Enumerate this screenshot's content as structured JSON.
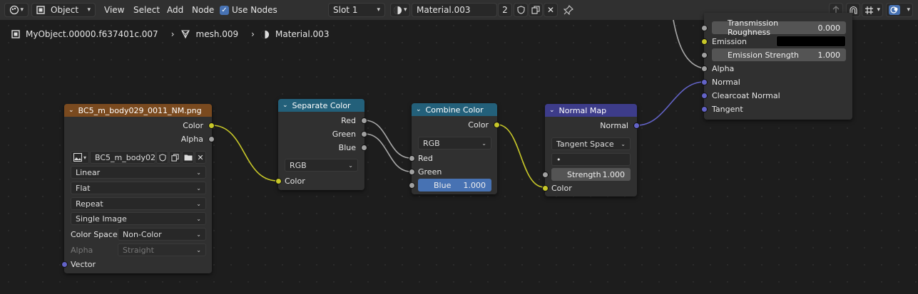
{
  "header": {
    "mode": "Object",
    "menus": [
      "View",
      "Select",
      "Add",
      "Node"
    ],
    "use_nodes": "Use Nodes",
    "slot": "Slot 1",
    "material": "Material.003",
    "user_count": "2"
  },
  "breadcrumb": {
    "object": "MyObject.00000.f637401c.007",
    "mesh": "mesh.009",
    "material": "Material.003"
  },
  "bsdf": {
    "transmission_roughness_label": "Transmission Roughness",
    "transmission_roughness_value": "0.000",
    "emission_label": "Emission",
    "emission_strength_label": "Emission Strength",
    "emission_strength_value": "1.000",
    "alpha": "Alpha",
    "normal": "Normal",
    "clearcoat_normal": "Clearcoat Normal",
    "tangent": "Tangent"
  },
  "image_node": {
    "title": "BC5_m_body029_0011_NM.png",
    "out_color": "Color",
    "out_alpha": "Alpha",
    "image_name": "BC5_m_body02...",
    "interpolation": "Linear",
    "projection": "Flat",
    "extension": "Repeat",
    "source": "Single Image",
    "color_space_label": "Color Space",
    "color_space": "Non-Color",
    "alpha_label": "Alpha",
    "alpha_mode": "Straight",
    "in_vector": "Vector"
  },
  "separate_node": {
    "title": "Separate Color",
    "out_red": "Red",
    "out_green": "Green",
    "out_blue": "Blue",
    "mode": "RGB",
    "in_color": "Color"
  },
  "combine_node": {
    "title": "Combine Color",
    "out_color": "Color",
    "mode": "RGB",
    "in_red": "Red",
    "in_green": "Green",
    "blue_label": "Blue",
    "blue_value": "1.000"
  },
  "normalmap_node": {
    "title": "Normal Map",
    "out_normal": "Normal",
    "space": "Tangent Space",
    "uv_map": "•",
    "strength_label": "Strength",
    "strength_value": "1.000",
    "in_color": "Color"
  },
  "colors": {
    "image_header": "#7a4a1f",
    "converter_header": "#23607a",
    "vector_header": "#3d3c8a",
    "socket_color": "#c7c729",
    "socket_float": "#a1a1a1",
    "socket_vector": "#6363c7"
  }
}
